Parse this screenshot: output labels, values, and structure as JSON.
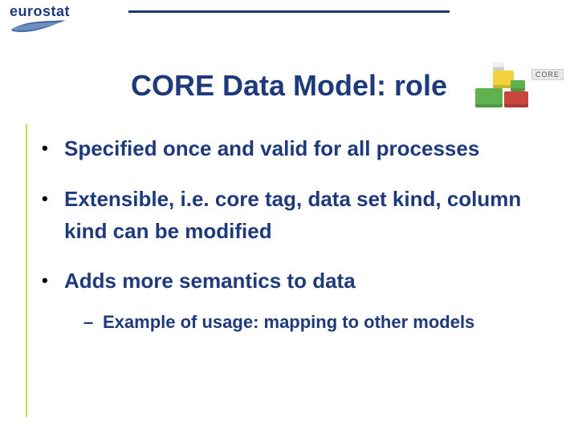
{
  "logo": {
    "text": "eurostat"
  },
  "core_logo": {
    "label": "CORE"
  },
  "title": "CORE Data Model: role",
  "bullets": [
    {
      "text": "Specified once and valid for all processes"
    },
    {
      "text": "Extensible, i.e. core tag, data set kind, column kind can be modified"
    },
    {
      "text": "Adds more semantics to data"
    }
  ],
  "sub_bullets": [
    {
      "text": "Example of usage: mapping to other models"
    }
  ],
  "colors": {
    "brand_blue": "#1f3a7a",
    "accent_border": "#c9d64a"
  }
}
